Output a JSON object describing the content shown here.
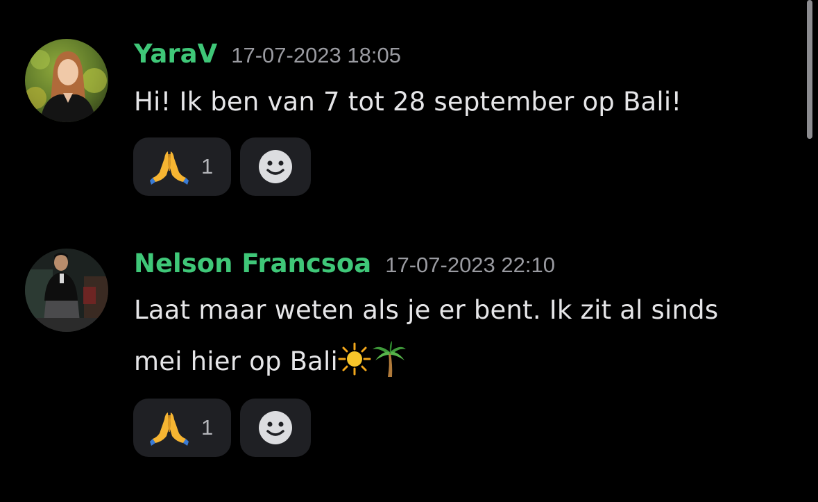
{
  "messages": [
    {
      "username": "YaraV",
      "timestamp": "17-07-2023 18:05",
      "text": "Hi! Ik ben van 7 tot 28 september op Bali!",
      "reactions": [
        {
          "emoji": "folded-hands",
          "count": "1"
        },
        {
          "emoji": "add-reaction-smiley"
        }
      ]
    },
    {
      "username": "Nelson Francsoa",
      "timestamp": "17-07-2023 22:10",
      "text_line1": "Laat maar weten als je er bent. Ik zit al sinds",
      "text_line2": "mei hier op Bali",
      "inline_emojis": [
        "sun",
        "palm-tree"
      ],
      "reactions": [
        {
          "emoji": "folded-hands",
          "count": "1"
        },
        {
          "emoji": "add-reaction-smiley"
        }
      ]
    }
  ],
  "colors": {
    "background": "#000000",
    "username": "#3fc778",
    "timestamp": "#9a9ba1",
    "message_text": "#e6e6e8",
    "reaction_bg": "#1f2024"
  }
}
